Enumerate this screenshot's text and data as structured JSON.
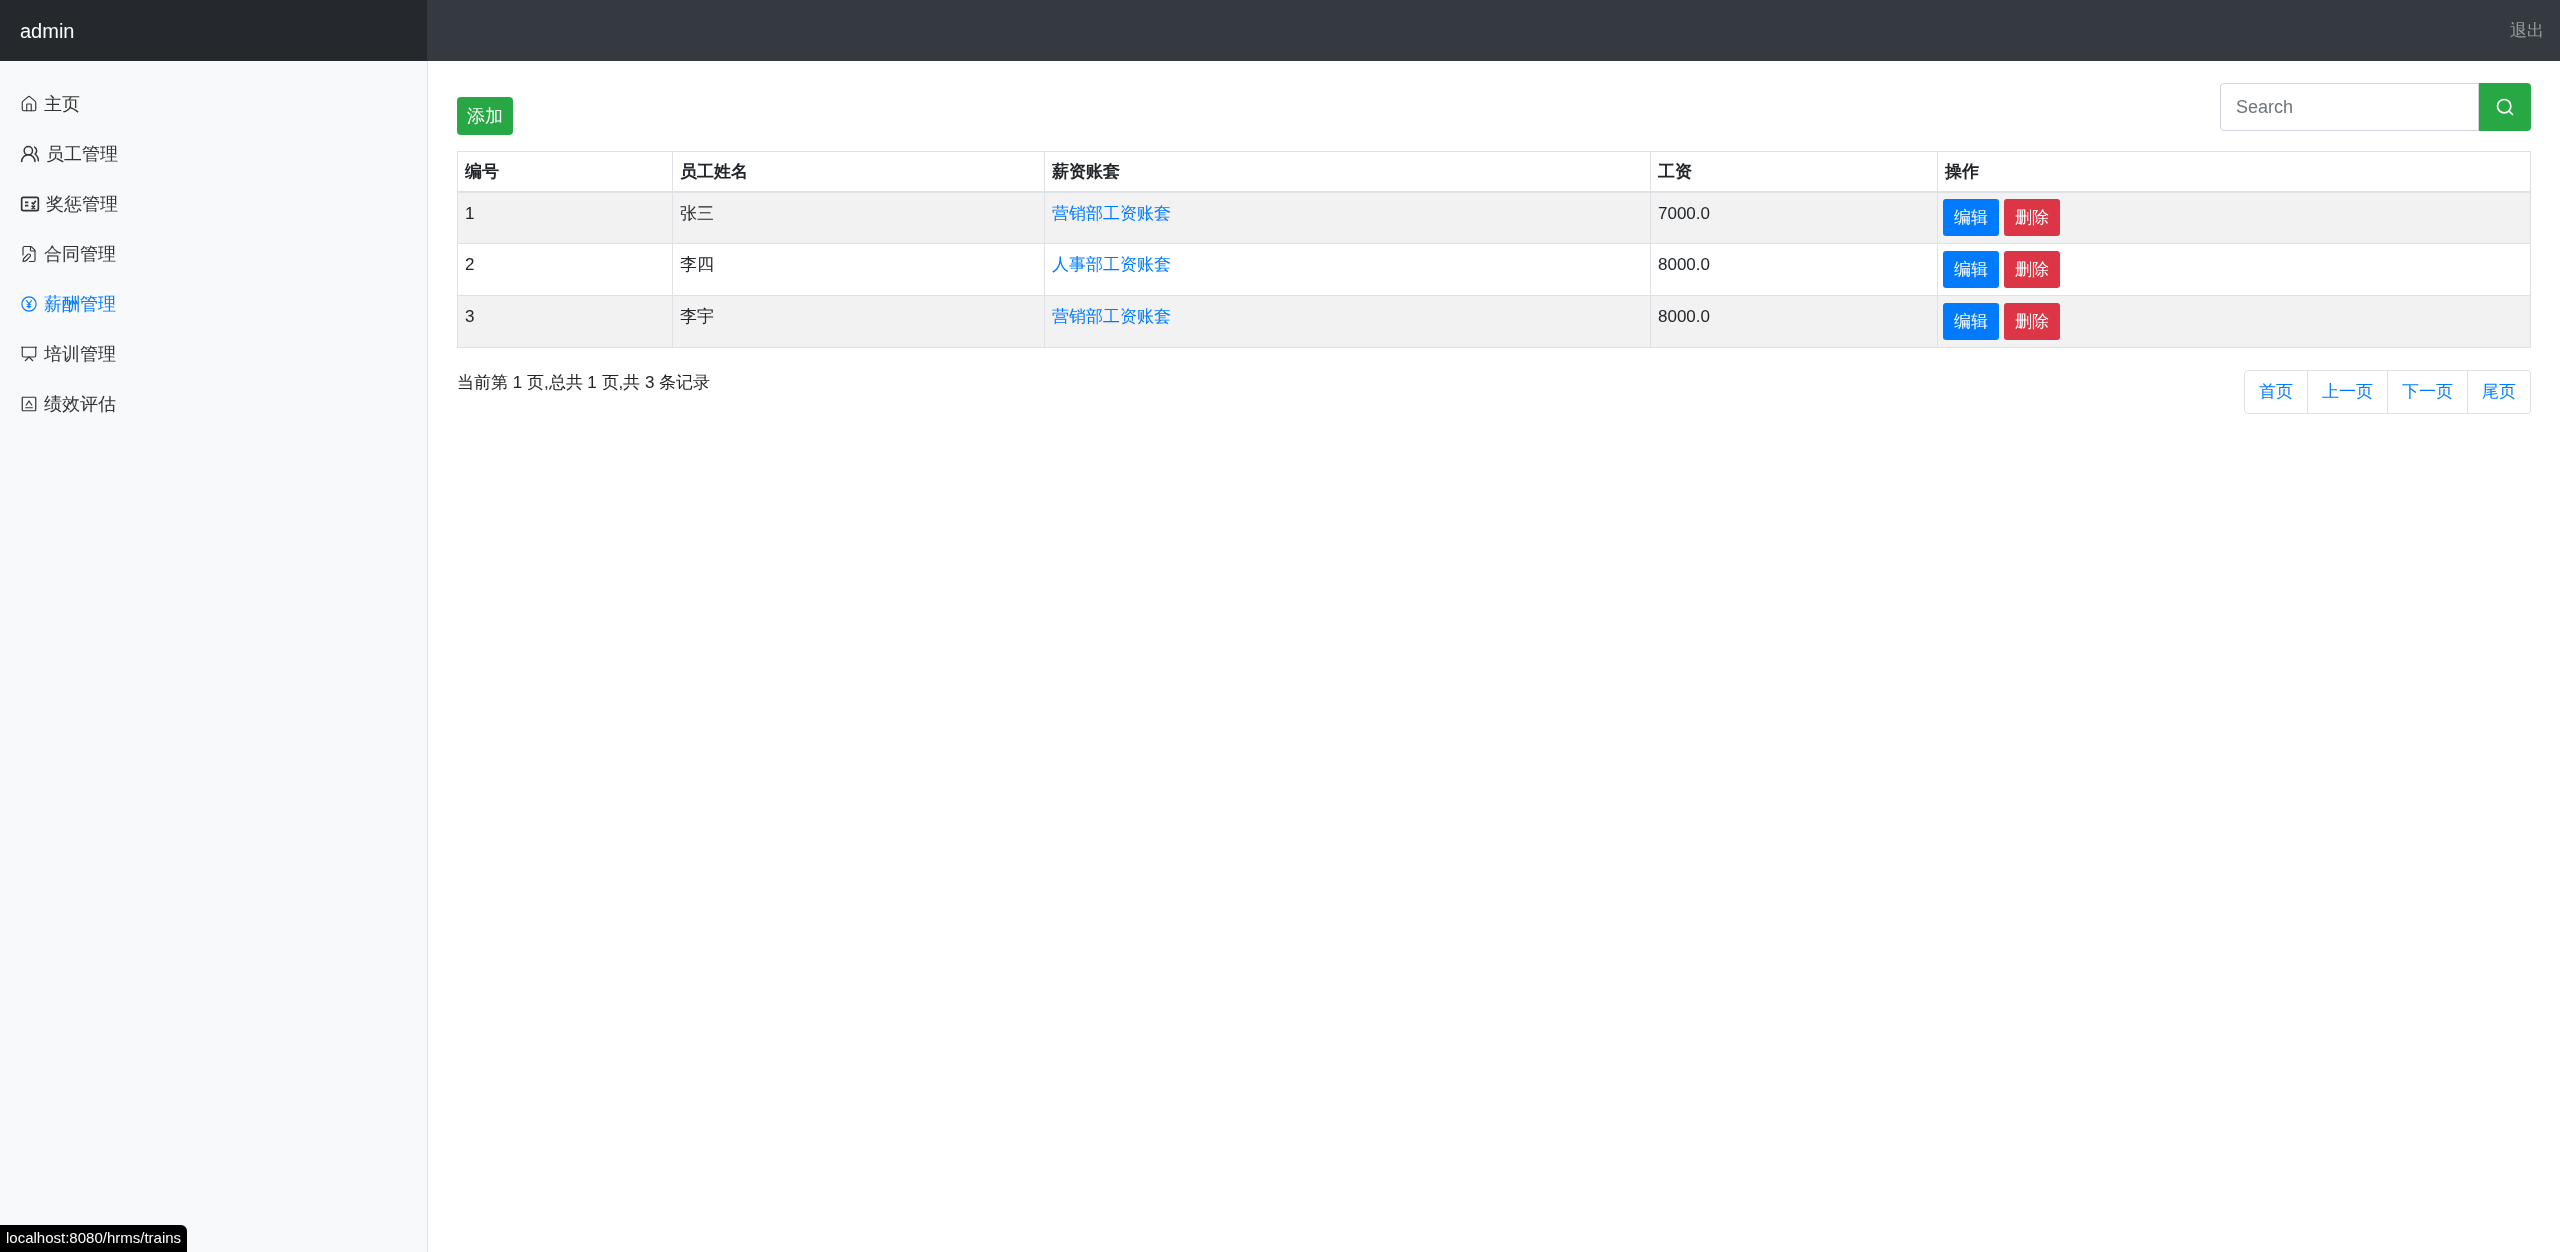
{
  "navbar": {
    "brand": "admin",
    "logout": "退出"
  },
  "sidebar": {
    "items": [
      {
        "label": "主页",
        "selected": false
      },
      {
        "label": "员工管理",
        "selected": false
      },
      {
        "label": "奖惩管理",
        "selected": false
      },
      {
        "label": "合同管理",
        "selected": false
      },
      {
        "label": "薪酬管理",
        "selected": true
      },
      {
        "label": "培训管理",
        "selected": false
      },
      {
        "label": "绩效评估",
        "selected": false
      }
    ]
  },
  "toolbar": {
    "add_button": "添加",
    "search": {
      "placeholder": "Search"
    }
  },
  "table": {
    "columns": [
      "编号",
      "员工姓名",
      "薪资账套",
      "工资",
      "操作"
    ],
    "rows": [
      {
        "id": "1",
        "name": "张三",
        "account": "营销部工资账套",
        "salary": "7000.0",
        "actions": [
          "编辑",
          "删除"
        ]
      },
      {
        "id": "2",
        "name": "李四",
        "account": "人事部工资账套",
        "salary": "8000.0",
        "actions": [
          "编辑",
          "删除"
        ]
      },
      {
        "id": "3",
        "name": "李宇",
        "account": "营销部工资账套",
        "salary": "8000.0",
        "actions": [
          "编辑",
          "删除"
        ]
      }
    ]
  },
  "pagination": {
    "summary": "当前第 1 页,总共 1 页,共 3 条记录",
    "buttons": [
      "首页",
      "上一页",
      "下一页",
      "尾页"
    ]
  },
  "status_url": "localhost:8080/hrms/trains"
}
